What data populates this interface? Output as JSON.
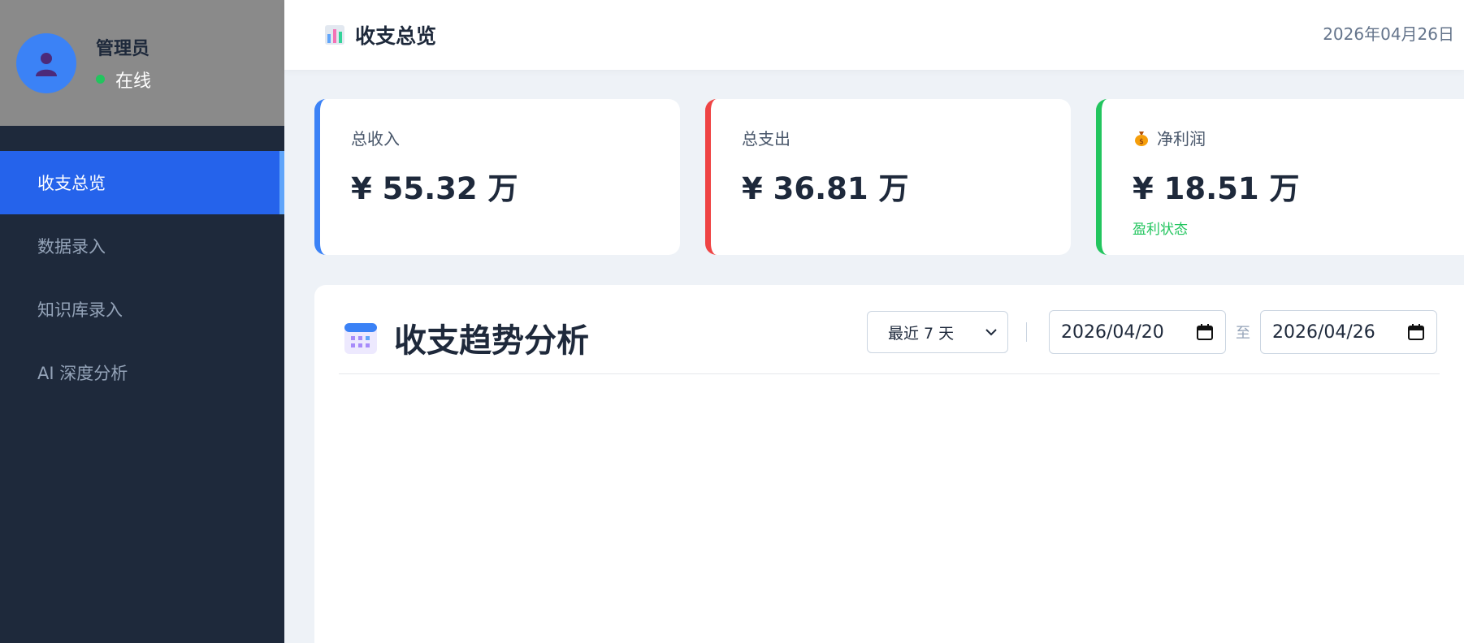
{
  "sidebar": {
    "user": {
      "name": "管理员",
      "status": "在线"
    },
    "items": [
      {
        "label": "收支总览",
        "active": true
      },
      {
        "label": "数据录入",
        "active": false
      },
      {
        "label": "知识库录入",
        "active": false
      },
      {
        "label": "AI 深度分析",
        "active": false
      }
    ]
  },
  "header": {
    "title": "收支总览",
    "date": "2026年04月26日",
    "icon": "bar-chart-icon"
  },
  "cards": {
    "income": {
      "label": "总收入",
      "value": "¥ 55.32 万",
      "color": "#3b82f6"
    },
    "expense": {
      "label": "总支出",
      "value": "¥ 36.81 万",
      "color": "#ef4444"
    },
    "profit": {
      "label": "净利润",
      "value": "¥ 18.51 万",
      "note": "盈利状态",
      "color": "#22c55e",
      "icon": "money-bag-icon"
    }
  },
  "trend": {
    "title": "收支趋势分析",
    "icon": "calendar-icon",
    "range": "最近 7 天",
    "date_from": "2026/04/20",
    "to_label": "至",
    "date_to": "2026/04/26"
  },
  "colors": {
    "sidebar_bg": "#1e293b",
    "accent": "#2563eb",
    "page_bg": "#eef2f7"
  }
}
